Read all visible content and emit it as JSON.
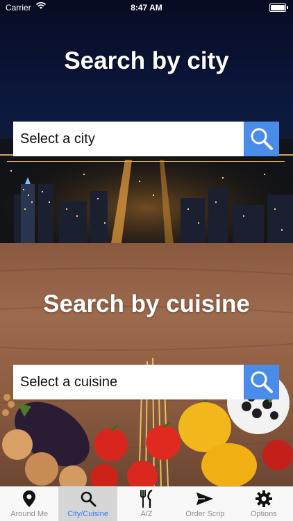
{
  "status_bar": {
    "carrier": "Carrier",
    "time": "8:47 AM"
  },
  "city_section": {
    "title": "Search by city",
    "select_placeholder": "Select a city",
    "search_icon": "magnifier-icon"
  },
  "cuisine_section": {
    "title": "Search by cuisine",
    "select_placeholder": "Select a cuisine",
    "search_icon": "magnifier-icon"
  },
  "tab_bar": {
    "active_color": "#3478f6",
    "items": [
      {
        "label": "Around Me",
        "icon": "map-pin-icon",
        "active": false
      },
      {
        "label": "City/Cuisine",
        "icon": "search-icon",
        "active": true
      },
      {
        "label": "A/Z",
        "icon": "fork-knife-icon",
        "active": false
      },
      {
        "label": "Order Scrip",
        "icon": "paper-plane-icon",
        "active": false
      },
      {
        "label": "Options",
        "icon": "gear-icon",
        "active": false
      }
    ]
  }
}
